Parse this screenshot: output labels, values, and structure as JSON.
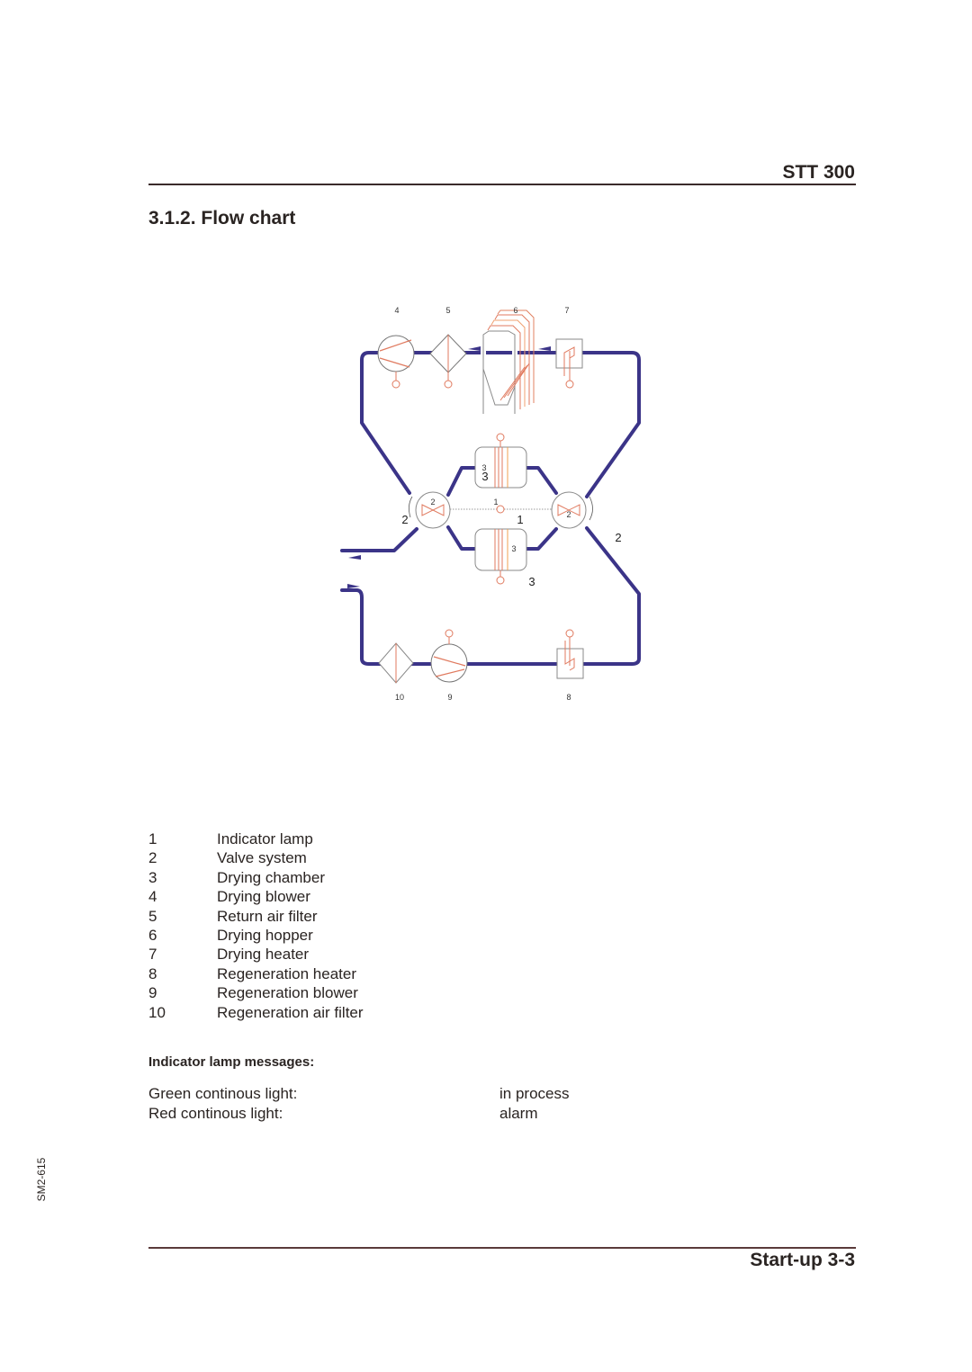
{
  "header": {
    "model": "STT 300",
    "section_title": "3.1.2. Flow chart"
  },
  "diagram": {
    "pipe_color": "#3b3488",
    "component_color": "#e07a5f",
    "outline_color": "#8a8a8a",
    "top_labels": [
      "4",
      "5",
      "6",
      "7"
    ],
    "bottom_labels": [
      "10",
      "9",
      "8"
    ],
    "valve_left_inner": "2",
    "valve_left_outer": "2",
    "valve_right_inner": "2",
    "valve_right_outer": "2",
    "lamp_inner": "1",
    "lamp_outer": "1",
    "chamber_top_inner": "3",
    "chamber_top_outer": "3",
    "chamber_bottom_inner": "3",
    "chamber_bottom_outer": "3"
  },
  "legend": [
    {
      "num": "1",
      "label": "Indicator lamp"
    },
    {
      "num": "2",
      "label": "Valve system"
    },
    {
      "num": "3",
      "label": "Drying chamber"
    },
    {
      "num": "4",
      "label": "Drying blower"
    },
    {
      "num": "5",
      "label": "Return air filter"
    },
    {
      "num": "6",
      "label": "Drying hopper"
    },
    {
      "num": "7",
      "label": "Drying heater"
    },
    {
      "num": "8",
      "label": "Regeneration heater"
    },
    {
      "num": "9",
      "label": "Regeneration blower"
    },
    {
      "num": "10",
      "label": "Regeneration air filter"
    }
  ],
  "lamp_messages": {
    "title": "Indicator lamp messages:",
    "rows": [
      {
        "label": "Green continous light:",
        "value": "in process"
      },
      {
        "label": "Red continous light:",
        "value": "alarm"
      }
    ]
  },
  "footer": {
    "page_label": "Start-up 3-3",
    "doc_code": "SM2-615"
  }
}
